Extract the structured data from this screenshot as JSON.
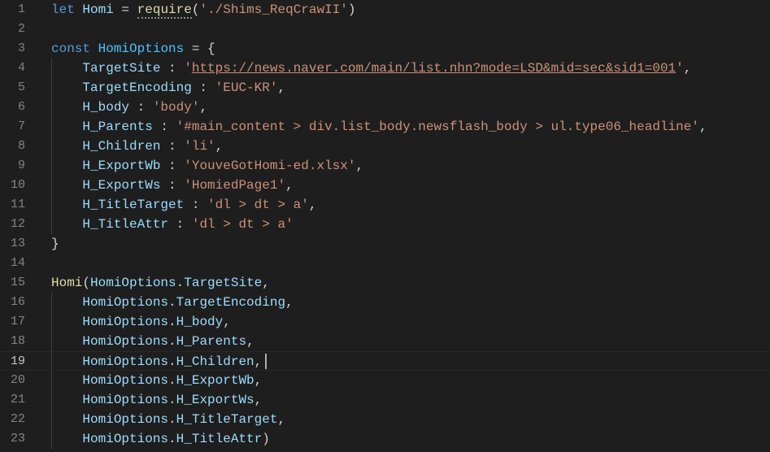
{
  "editor": {
    "theme_colors": {
      "background": "#1e1e1e",
      "keyword": "#569cd6",
      "variable": "#9cdcfe",
      "constant": "#4fc1ff",
      "function": "#dcdcaa",
      "string": "#ce9178",
      "line_number": "#858585"
    },
    "current_line": 19,
    "lines": [
      {
        "n": "1",
        "t": [
          {
            "c": "kw",
            "v": "let"
          },
          {
            "c": "punc",
            "v": " "
          },
          {
            "c": "var",
            "v": "Homi"
          },
          {
            "c": "punc",
            "v": " = "
          },
          {
            "c": "fn",
            "v": "require",
            "d": true
          },
          {
            "c": "punc",
            "v": "("
          },
          {
            "c": "str",
            "v": "'./Shims_ReqCrawII'"
          },
          {
            "c": "punc",
            "v": ")"
          }
        ]
      },
      {
        "n": "2",
        "t": []
      },
      {
        "n": "3",
        "t": [
          {
            "c": "kw",
            "v": "const"
          },
          {
            "c": "punc",
            "v": " "
          },
          {
            "c": "const",
            "v": "HomiOptions"
          },
          {
            "c": "punc",
            "v": " = {"
          }
        ]
      },
      {
        "n": "4",
        "t": [
          {
            "c": "punc",
            "v": "    "
          },
          {
            "c": "prop",
            "v": "TargetSite"
          },
          {
            "c": "punc",
            "v": " : "
          },
          {
            "c": "str",
            "v": "'"
          },
          {
            "c": "str",
            "v": "https://news.naver.com/main/list.nhn?mode=LSD&mid=sec&sid1=001",
            "u": true
          },
          {
            "c": "str",
            "v": "'"
          },
          {
            "c": "punc",
            "v": ","
          }
        ]
      },
      {
        "n": "5",
        "t": [
          {
            "c": "punc",
            "v": "    "
          },
          {
            "c": "prop",
            "v": "TargetEncoding"
          },
          {
            "c": "punc",
            "v": " : "
          },
          {
            "c": "str",
            "v": "'EUC-KR'"
          },
          {
            "c": "punc",
            "v": ","
          }
        ]
      },
      {
        "n": "6",
        "t": [
          {
            "c": "punc",
            "v": "    "
          },
          {
            "c": "prop",
            "v": "H_body"
          },
          {
            "c": "punc",
            "v": " : "
          },
          {
            "c": "str",
            "v": "'body'"
          },
          {
            "c": "punc",
            "v": ","
          }
        ]
      },
      {
        "n": "7",
        "t": [
          {
            "c": "punc",
            "v": "    "
          },
          {
            "c": "prop",
            "v": "H_Parents"
          },
          {
            "c": "punc",
            "v": " : "
          },
          {
            "c": "str",
            "v": "'#main_content > div.list_body.newsflash_body > ul.type06_headline'"
          },
          {
            "c": "punc",
            "v": ","
          }
        ]
      },
      {
        "n": "8",
        "t": [
          {
            "c": "punc",
            "v": "    "
          },
          {
            "c": "prop",
            "v": "H_Children"
          },
          {
            "c": "punc",
            "v": " : "
          },
          {
            "c": "str",
            "v": "'li'"
          },
          {
            "c": "punc",
            "v": ","
          }
        ]
      },
      {
        "n": "9",
        "t": [
          {
            "c": "punc",
            "v": "    "
          },
          {
            "c": "prop",
            "v": "H_ExportWb"
          },
          {
            "c": "punc",
            "v": " : "
          },
          {
            "c": "str",
            "v": "'YouveGotHomi-ed.xlsx'"
          },
          {
            "c": "punc",
            "v": ","
          }
        ]
      },
      {
        "n": "10",
        "t": [
          {
            "c": "punc",
            "v": "    "
          },
          {
            "c": "prop",
            "v": "H_ExportWs"
          },
          {
            "c": "punc",
            "v": " : "
          },
          {
            "c": "str",
            "v": "'HomiedPage1'"
          },
          {
            "c": "punc",
            "v": ","
          }
        ]
      },
      {
        "n": "11",
        "t": [
          {
            "c": "punc",
            "v": "    "
          },
          {
            "c": "prop",
            "v": "H_TitleTarget"
          },
          {
            "c": "punc",
            "v": " : "
          },
          {
            "c": "str",
            "v": "'dl > dt > a'"
          },
          {
            "c": "punc",
            "v": ","
          }
        ]
      },
      {
        "n": "12",
        "t": [
          {
            "c": "punc",
            "v": "    "
          },
          {
            "c": "prop",
            "v": "H_TitleAttr"
          },
          {
            "c": "punc",
            "v": " : "
          },
          {
            "c": "str",
            "v": "'dl > dt > a'"
          }
        ]
      },
      {
        "n": "13",
        "t": [
          {
            "c": "punc",
            "v": "}"
          }
        ]
      },
      {
        "n": "14",
        "t": []
      },
      {
        "n": "15",
        "t": [
          {
            "c": "fn",
            "v": "Homi"
          },
          {
            "c": "punc",
            "v": "("
          },
          {
            "c": "var",
            "v": "HomiOptions"
          },
          {
            "c": "punc",
            "v": "."
          },
          {
            "c": "prop",
            "v": "TargetSite"
          },
          {
            "c": "punc",
            "v": ","
          }
        ]
      },
      {
        "n": "16",
        "t": [
          {
            "c": "punc",
            "v": "    "
          },
          {
            "c": "var",
            "v": "HomiOptions"
          },
          {
            "c": "punc",
            "v": "."
          },
          {
            "c": "prop",
            "v": "TargetEncoding"
          },
          {
            "c": "punc",
            "v": ","
          }
        ]
      },
      {
        "n": "17",
        "t": [
          {
            "c": "punc",
            "v": "    "
          },
          {
            "c": "var",
            "v": "HomiOptions"
          },
          {
            "c": "punc",
            "v": "."
          },
          {
            "c": "prop",
            "v": "H_body"
          },
          {
            "c": "punc",
            "v": ","
          }
        ]
      },
      {
        "n": "18",
        "t": [
          {
            "c": "punc",
            "v": "    "
          },
          {
            "c": "var",
            "v": "HomiOptions"
          },
          {
            "c": "punc",
            "v": "."
          },
          {
            "c": "prop",
            "v": "H_Parents"
          },
          {
            "c": "punc",
            "v": ","
          }
        ]
      },
      {
        "n": "19",
        "t": [
          {
            "c": "punc",
            "v": "    "
          },
          {
            "c": "var",
            "v": "HomiOptions"
          },
          {
            "c": "punc",
            "v": "."
          },
          {
            "c": "prop",
            "v": "H_Children"
          },
          {
            "c": "punc",
            "v": ","
          }
        ]
      },
      {
        "n": "20",
        "t": [
          {
            "c": "punc",
            "v": "    "
          },
          {
            "c": "var",
            "v": "HomiOptions"
          },
          {
            "c": "punc",
            "v": "."
          },
          {
            "c": "prop",
            "v": "H_ExportWb"
          },
          {
            "c": "punc",
            "v": ","
          }
        ]
      },
      {
        "n": "21",
        "t": [
          {
            "c": "punc",
            "v": "    "
          },
          {
            "c": "var",
            "v": "HomiOptions"
          },
          {
            "c": "punc",
            "v": "."
          },
          {
            "c": "prop",
            "v": "H_ExportWs"
          },
          {
            "c": "punc",
            "v": ","
          }
        ]
      },
      {
        "n": "22",
        "t": [
          {
            "c": "punc",
            "v": "    "
          },
          {
            "c": "var",
            "v": "HomiOptions"
          },
          {
            "c": "punc",
            "v": "."
          },
          {
            "c": "prop",
            "v": "H_TitleTarget"
          },
          {
            "c": "punc",
            "v": ","
          }
        ]
      },
      {
        "n": "23",
        "t": [
          {
            "c": "punc",
            "v": "    "
          },
          {
            "c": "var",
            "v": "HomiOptions"
          },
          {
            "c": "punc",
            "v": "."
          },
          {
            "c": "prop",
            "v": "H_TitleAttr"
          },
          {
            "c": "punc",
            "v": ")"
          }
        ]
      }
    ]
  }
}
